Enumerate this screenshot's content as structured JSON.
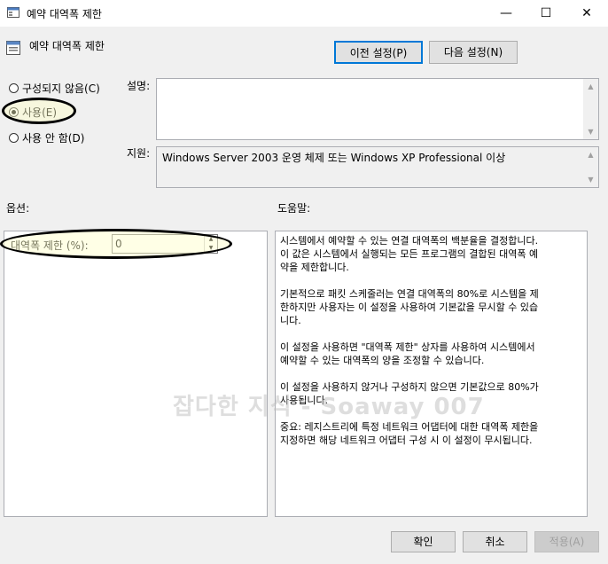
{
  "window": {
    "title": "예약 대역폭 제한",
    "minimize_glyph": "—",
    "maximize_glyph": "☐",
    "close_glyph": "✕"
  },
  "header": {
    "setting_title": "예약 대역폭 제한",
    "prev_button": "이전 설정(P)",
    "next_button": "다음 설정(N)"
  },
  "state": {
    "options": [
      {
        "label": "구성되지 않음(C)",
        "selected": false
      },
      {
        "label": "사용(E)",
        "selected": true
      },
      {
        "label": "사용 안 함(D)",
        "selected": false
      }
    ]
  },
  "comment": {
    "label": "설명:",
    "value": ""
  },
  "supported_on": {
    "label": "지원:",
    "value": "Windows Server 2003 운영 체제 또는 Windows XP Professional 이상"
  },
  "options_section": {
    "label": "옵션:",
    "field_label": "대역폭 제한 (%):",
    "field_value": "0"
  },
  "help_section": {
    "label": "도움말:",
    "text": "시스템에서 예약할 수 있는 연결 대역폭의 백분율을 결정합니다.\n이 값은 시스템에서 실행되는 모든 프로그램의 결합된 대역폭 예\n약을 제한합니다.\n\n기본적으로 패킷 스케줄러는 연결 대역폭의 80%로 시스템을 제\n한하지만 사용자는 이 설정을 사용하여 기본값을 무시할 수 있습\n니다.\n\n이 설정을 사용하면 \"대역폭 제한\" 상자를 사용하여 시스템에서\n예약할 수 있는 대역폭의 양을 조정할 수 있습니다.\n\n이 설정을 사용하지 않거나 구성하지 않으면 기본값으로 80%가\n사용됩니다.\n\n중요: 레지스트리에 특정 네트워크 어댑터에 대한 대역폭 제한을\n지정하면 해당 네트워크 어댑터 구성 시 이 설정이 무시됩니다."
  },
  "footer": {
    "ok": "확인",
    "cancel": "취소",
    "apply": "적용(A)"
  },
  "watermark": "잡다한 지식 - Soaway 007"
}
